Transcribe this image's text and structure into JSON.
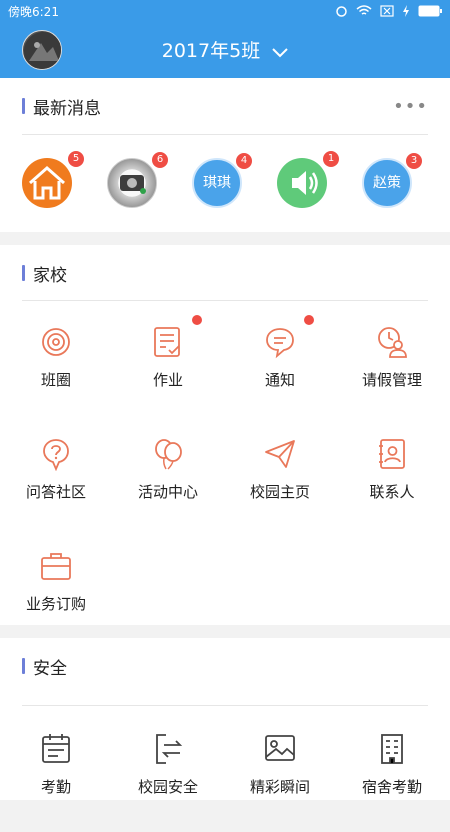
{
  "status": {
    "time": "傍晚6:21",
    "icon_names": [
      "sync-icon",
      "wifi-icon",
      "sim-off-icon",
      "charging-icon",
      "battery-icon"
    ]
  },
  "header": {
    "class_name": "2017年5班",
    "dropdown_icon": "chevron-down-icon",
    "avatar_icon": "avatar-icon"
  },
  "latest": {
    "title": "最新消息",
    "more_icon": "more-dots-icon",
    "items": [
      {
        "icon": "home-icon",
        "badge": "5",
        "label": ""
      },
      {
        "icon": "photo-avatar",
        "badge": "6",
        "label": ""
      },
      {
        "icon": "text-avatar",
        "badge": "4",
        "label": "琪琪"
      },
      {
        "icon": "speaker-icon",
        "badge": "1",
        "label": ""
      },
      {
        "icon": "text-avatar",
        "badge": "3",
        "label": "赵策"
      }
    ]
  },
  "home_school": {
    "title": "家校",
    "items": [
      {
        "label": "班圈",
        "icon": "circle-target-icon"
      },
      {
        "label": "作业",
        "icon": "homework-icon",
        "dot": true
      },
      {
        "label": "通知",
        "icon": "chat-bubble-icon",
        "dot": true
      },
      {
        "label": "请假管理",
        "icon": "leave-clock-person-icon"
      },
      {
        "label": "问答社区",
        "icon": "question-bubble-icon"
      },
      {
        "label": "活动中心",
        "icon": "balloons-icon"
      },
      {
        "label": "校园主页",
        "icon": "paper-plane-icon"
      },
      {
        "label": "联系人",
        "icon": "contact-card-icon"
      },
      {
        "label": "业务订购",
        "icon": "briefcase-icon"
      }
    ]
  },
  "safety": {
    "title": "安全",
    "items": [
      {
        "label": "考勤",
        "icon": "attendance-calendar-icon"
      },
      {
        "label": "校园安全",
        "icon": "door-arrows-icon"
      },
      {
        "label": "精彩瞬间",
        "icon": "image-icon"
      },
      {
        "label": "宿舍考勤",
        "icon": "building-icon"
      }
    ]
  },
  "colors": {
    "primary": "#3a9be8",
    "accent_icon": "#e9785a",
    "section_bar": "#6d7fd8",
    "badge": "#ef4d44"
  }
}
